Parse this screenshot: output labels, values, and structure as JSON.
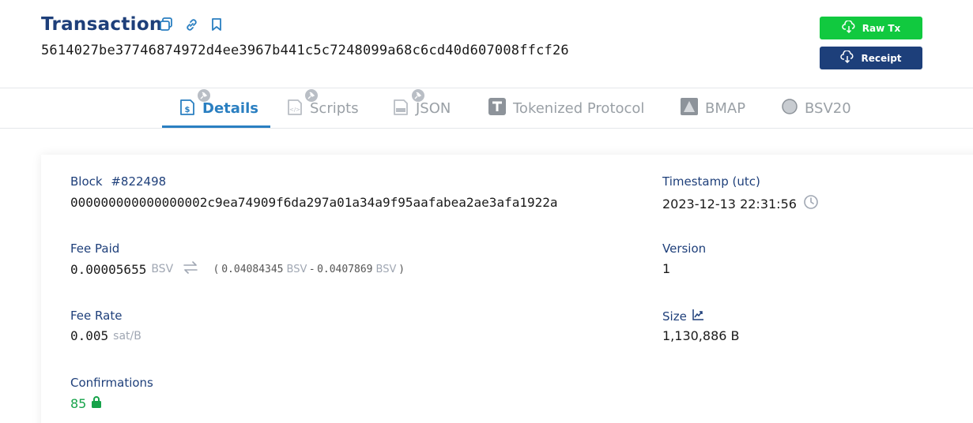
{
  "header": {
    "title": "Transaction",
    "txid": "5614027be37746874972d4ee3967b441c5c7248099a68c6cd40d607008ffcf26",
    "raw_tx_label": "Raw Tx",
    "receipt_label": "Receipt"
  },
  "tabs": [
    {
      "label": "Details",
      "active": true
    },
    {
      "label": "Scripts",
      "active": false
    },
    {
      "label": "JSON",
      "active": false
    },
    {
      "label": "Tokenized Protocol",
      "active": false
    },
    {
      "label": "BMAP",
      "active": false
    },
    {
      "label": "BSV20",
      "active": false
    }
  ],
  "details": {
    "block_label": "Block",
    "block_number": "#822498",
    "block_hash": "000000000000000002c9ea74909f6da297a01a34a9f95aafabea2ae3afa1922a",
    "timestamp_label": "Timestamp (utc)",
    "timestamp_value": "2023-12-13 22:31:56",
    "fee_paid_label": "Fee Paid",
    "fee_paid_value": "0.00005655",
    "fee_unit": "BSV",
    "fee_open": "(",
    "fee_input": "0.04084345",
    "fee_minus": "-",
    "fee_output": "0.0407869",
    "fee_close": ")",
    "version_label": "Version",
    "version_value": "1",
    "fee_rate_label": "Fee Rate",
    "fee_rate_value": "0.005",
    "fee_rate_unit": "sat/B",
    "size_label": "Size",
    "size_value": "1,130,886 B",
    "confirmations_label": "Confirmations",
    "confirmations_value": "85"
  },
  "colors": {
    "brand_navy": "#1d3f7a",
    "accent_green": "#11c93f",
    "tab_active": "#2a7fc1"
  }
}
